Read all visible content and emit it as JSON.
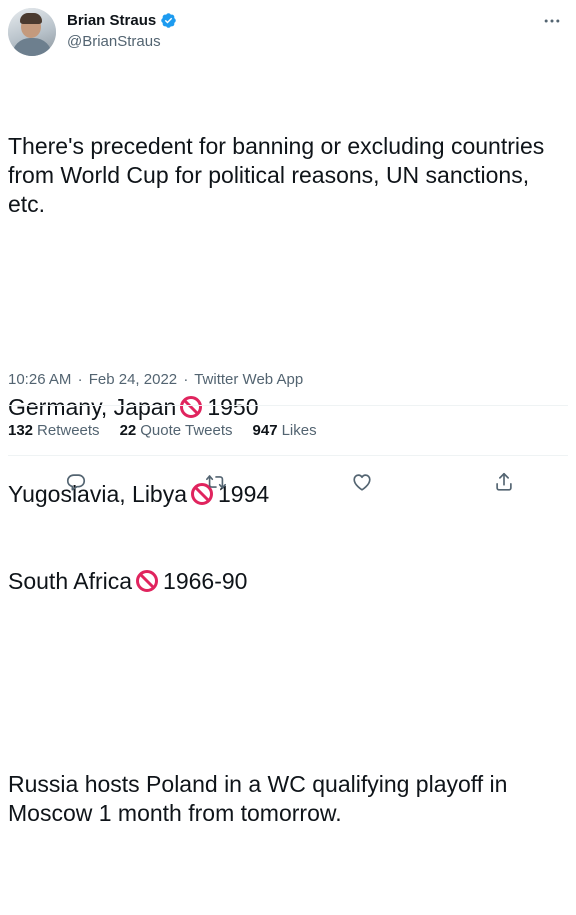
{
  "author": {
    "display_name": "Brian Straus",
    "handle": "@BrianStraus",
    "verified_icon": "verified-badge-icon",
    "avatar_icon": "profile-photo"
  },
  "more_icon": "more-horizontal-icon",
  "body": {
    "p1": "There's precedent for banning or excluding countries from World Cup for political reasons, UN sanctions, etc.",
    "lines": [
      {
        "left": "Germany, Japan",
        "right": "1950"
      },
      {
        "left": "Yugoslavia, Libya",
        "right": "1994"
      },
      {
        "left": "South Africa",
        "right": "1966-90"
      }
    ],
    "p3": "Russia hosts Poland in a WC qualifying playoff in Moscow 1 month from tomorrow."
  },
  "meta": {
    "time": "10:26 AM",
    "sep1": "·",
    "date": "Feb 24, 2022",
    "sep2": "·",
    "source": "Twitter Web App"
  },
  "stats": {
    "retweets": {
      "num": "132",
      "label": "Retweets"
    },
    "quotes": {
      "num": "22",
      "label": "Quote Tweets"
    },
    "likes": {
      "num": "947",
      "label": "Likes"
    }
  },
  "actions": [
    "reply-icon",
    "retweet-icon",
    "like-icon",
    "share-icon"
  ],
  "colors": {
    "text": "#0f1419",
    "secondary": "#536471",
    "verified": "#1d9bf0",
    "no_entry": "#e0245e",
    "divider": "#eff3f4"
  }
}
